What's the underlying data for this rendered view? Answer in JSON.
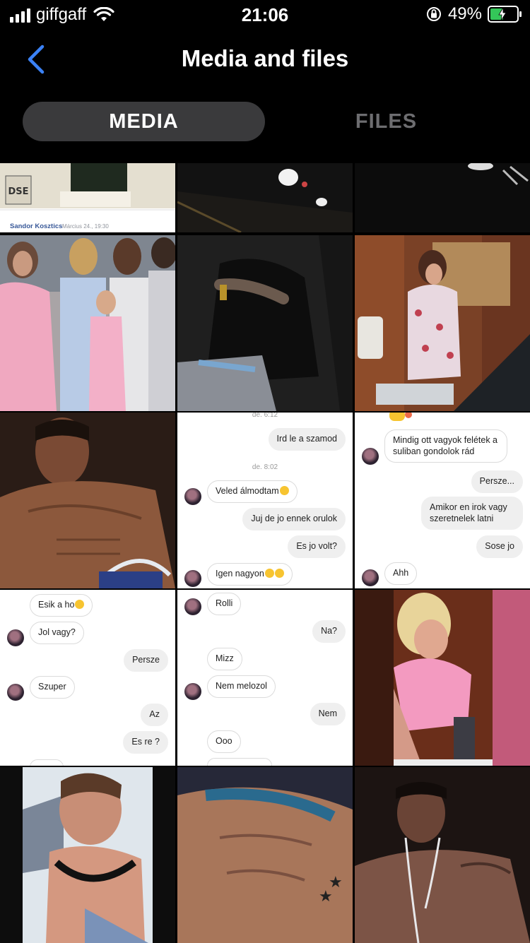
{
  "status_bar": {
    "carrier": "giffgaff",
    "time": "21:06",
    "battery_percent": "49%",
    "battery_level": 0.49,
    "icons": [
      "signal-bars-icon",
      "wifi-icon",
      "orientation-lock-icon",
      "battery-charging-icon"
    ]
  },
  "nav": {
    "back_icon": "chevron-left-icon",
    "title": "Media and files"
  },
  "segments": {
    "media": "MEDIA",
    "files": "FILES",
    "selected": "MEDIA"
  },
  "colors": {
    "accent": "#3b82f6",
    "segment_selected_bg": "#3a3a3c",
    "segment_inactive_text": "#6d6d70",
    "battery_green": "#34c759"
  },
  "tiles": {
    "tile1": {
      "author": "Sandor Kosztics",
      "date": "Március 24., 19:30"
    },
    "tile8": {
      "top_time": "de. 6:12",
      "time": "de. 8:02",
      "messages": [
        "Ird le a szamod",
        "Veled álmodtam",
        "Juj de jo ennek orulok",
        "Es jo volt?",
        "Igen nagyon"
      ]
    },
    "tile9": {
      "messages": [
        "Mindig ott vagyok felétek a suliban gondolok rád",
        "Persze...",
        "Amikor en irok vagy szeretnelek latni",
        "Sose jo",
        "Ahh"
      ]
    },
    "tile10": {
      "messages": [
        "Esik a ho",
        "Jol vagy?",
        "Persze",
        "Szuper",
        "Az",
        "Es re ?"
      ]
    },
    "tile11": {
      "messages": [
        "Rolli",
        "Na?",
        "Mizz",
        "Nem melozol",
        "Nem",
        "Ooo"
      ]
    }
  }
}
